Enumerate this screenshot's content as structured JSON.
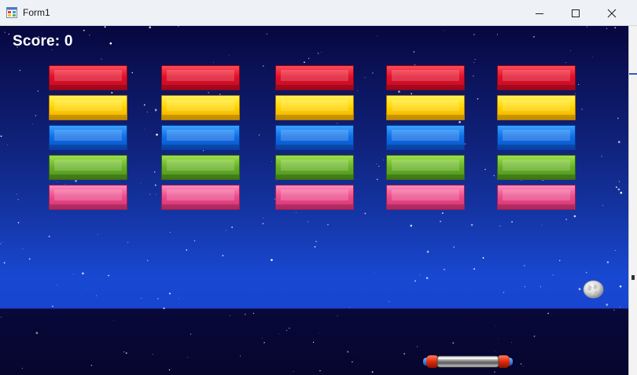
{
  "window": {
    "title": "Form1",
    "controls": [
      "minimize-icon",
      "maximize-icon",
      "close-icon"
    ]
  },
  "game": {
    "score_text": "Score: 0",
    "score": 0,
    "brick_rows": [
      "red",
      "yellow",
      "blue",
      "green",
      "pink"
    ],
    "brick_columns": 5,
    "colors": {
      "red": "#e0102b",
      "yellow": "#ffd800",
      "blue": "#1070e8",
      "green": "#69b42a",
      "pink": "#ec4d8c"
    },
    "ball_icon": "ball-icon",
    "paddle_icon": "paddle-icon"
  }
}
